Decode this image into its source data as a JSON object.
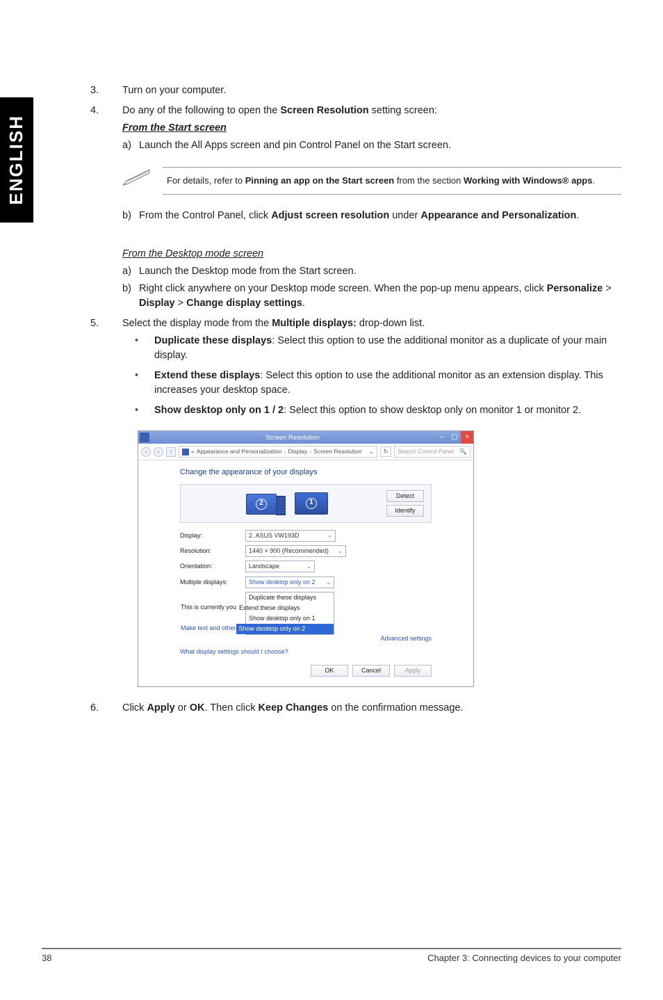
{
  "sidebar": {
    "language": "ENGLISH"
  },
  "steps": {
    "s3": {
      "num": "3.",
      "text": "Turn on your computer."
    },
    "s4": {
      "num": "4.",
      "intro_pre": "Do any of the following to open the ",
      "intro_bold": "Screen Resolution",
      "intro_post": " setting screen:",
      "from_start": "From the Start screen",
      "a_label": "a)",
      "a_text": "Launch the All Apps screen and pin Control Panel on the Start screen.",
      "note_pre": "For details, refer to ",
      "note_b1": "Pinning an app on the Start screen",
      "note_mid": " from the section ",
      "note_b2": "Working with Windows® apps",
      "note_post": ".",
      "b_label": "b)",
      "b_pre": "From the Control Panel, click ",
      "b_b1": "Adjust screen resolution",
      "b_mid": " under ",
      "b_b2": "Appearance and Personalization",
      "b_post": ".",
      "from_desktop": "From the Desktop mode screen",
      "da_label": "a)",
      "da_text": "Launch the Desktop mode from the Start screen.",
      "db_label": "b)",
      "db_pre": "Right click anywhere on your Desktop mode screen. When the pop-up menu appears, click ",
      "db_b1": "Personalize",
      "db_gt": " > ",
      "db_b2": "Display",
      "db_b3": "Change display settings",
      "db_post": "."
    },
    "s5": {
      "num": "5.",
      "pre": "Select the display mode from the ",
      "bold": "Multiple displays:",
      "post": " drop-down list.",
      "bullet": "•",
      "i1_b": "Duplicate these displays",
      "i1_t": ": Select this option to use the additional monitor as a duplicate of your main display.",
      "i2_b": "Extend these displays",
      "i2_t": ": Select this option to use the additional monitor as an extension display. This increases your desktop space.",
      "i3_b": "Show desktop only on 1 / 2",
      "i3_t": ": Select this option to show desktop only on monitor 1 or monitor 2."
    },
    "s6": {
      "num": "6.",
      "pre": "Click ",
      "b1": "Apply",
      "mid1": " or ",
      "b2": "OK",
      "mid2": ". Then click ",
      "b3": "Keep Changes",
      "post": " on the confirmation message."
    }
  },
  "window": {
    "title": "Screen Resolution",
    "min": "–",
    "max": "▢",
    "close": "×",
    "nav_back": "‹",
    "nav_fwd": "›",
    "nav_up": "↑",
    "crumb_pre": "«",
    "crumb1": "Appearance and Personalization",
    "crumb2": "Display",
    "crumb3": "Screen Resolution",
    "sep": "›",
    "refresh": "↻",
    "search_placeholder": "Search Control Panel",
    "mag": "🔍",
    "heading": "Change the appearance of your displays",
    "detect": "Detect",
    "identify": "Identify",
    "mon1": "1",
    "mon2": "2",
    "display_label": "Display:",
    "display_value": "2. ASUS VW193D",
    "resolution_label": "Resolution:",
    "resolution_value": "1440 × 900 (Recommended)",
    "orientation_label": "Orientation:",
    "orientation_value": "Landscape",
    "multiple_label": "Multiple displays:",
    "multiple_value": "Show desktop only on 2",
    "dd_opt1": "Duplicate these displays",
    "dd_opt2": "Extend these displays",
    "dd_opt3": "Show desktop only on 1",
    "dd_opt4": "Show desktop only on 2",
    "main_text_left": "This is currently you",
    "make_text": "Make text and other",
    "advanced": "Advanced settings",
    "what": "What display settings should I choose?",
    "ok": "OK",
    "cancel": "Cancel",
    "apply": "Apply",
    "caret": "⌄",
    "dd_caret": "▾"
  },
  "footer": {
    "page": "38",
    "chapter": "Chapter 3: Connecting devices to your computer"
  },
  "chart_data": null
}
